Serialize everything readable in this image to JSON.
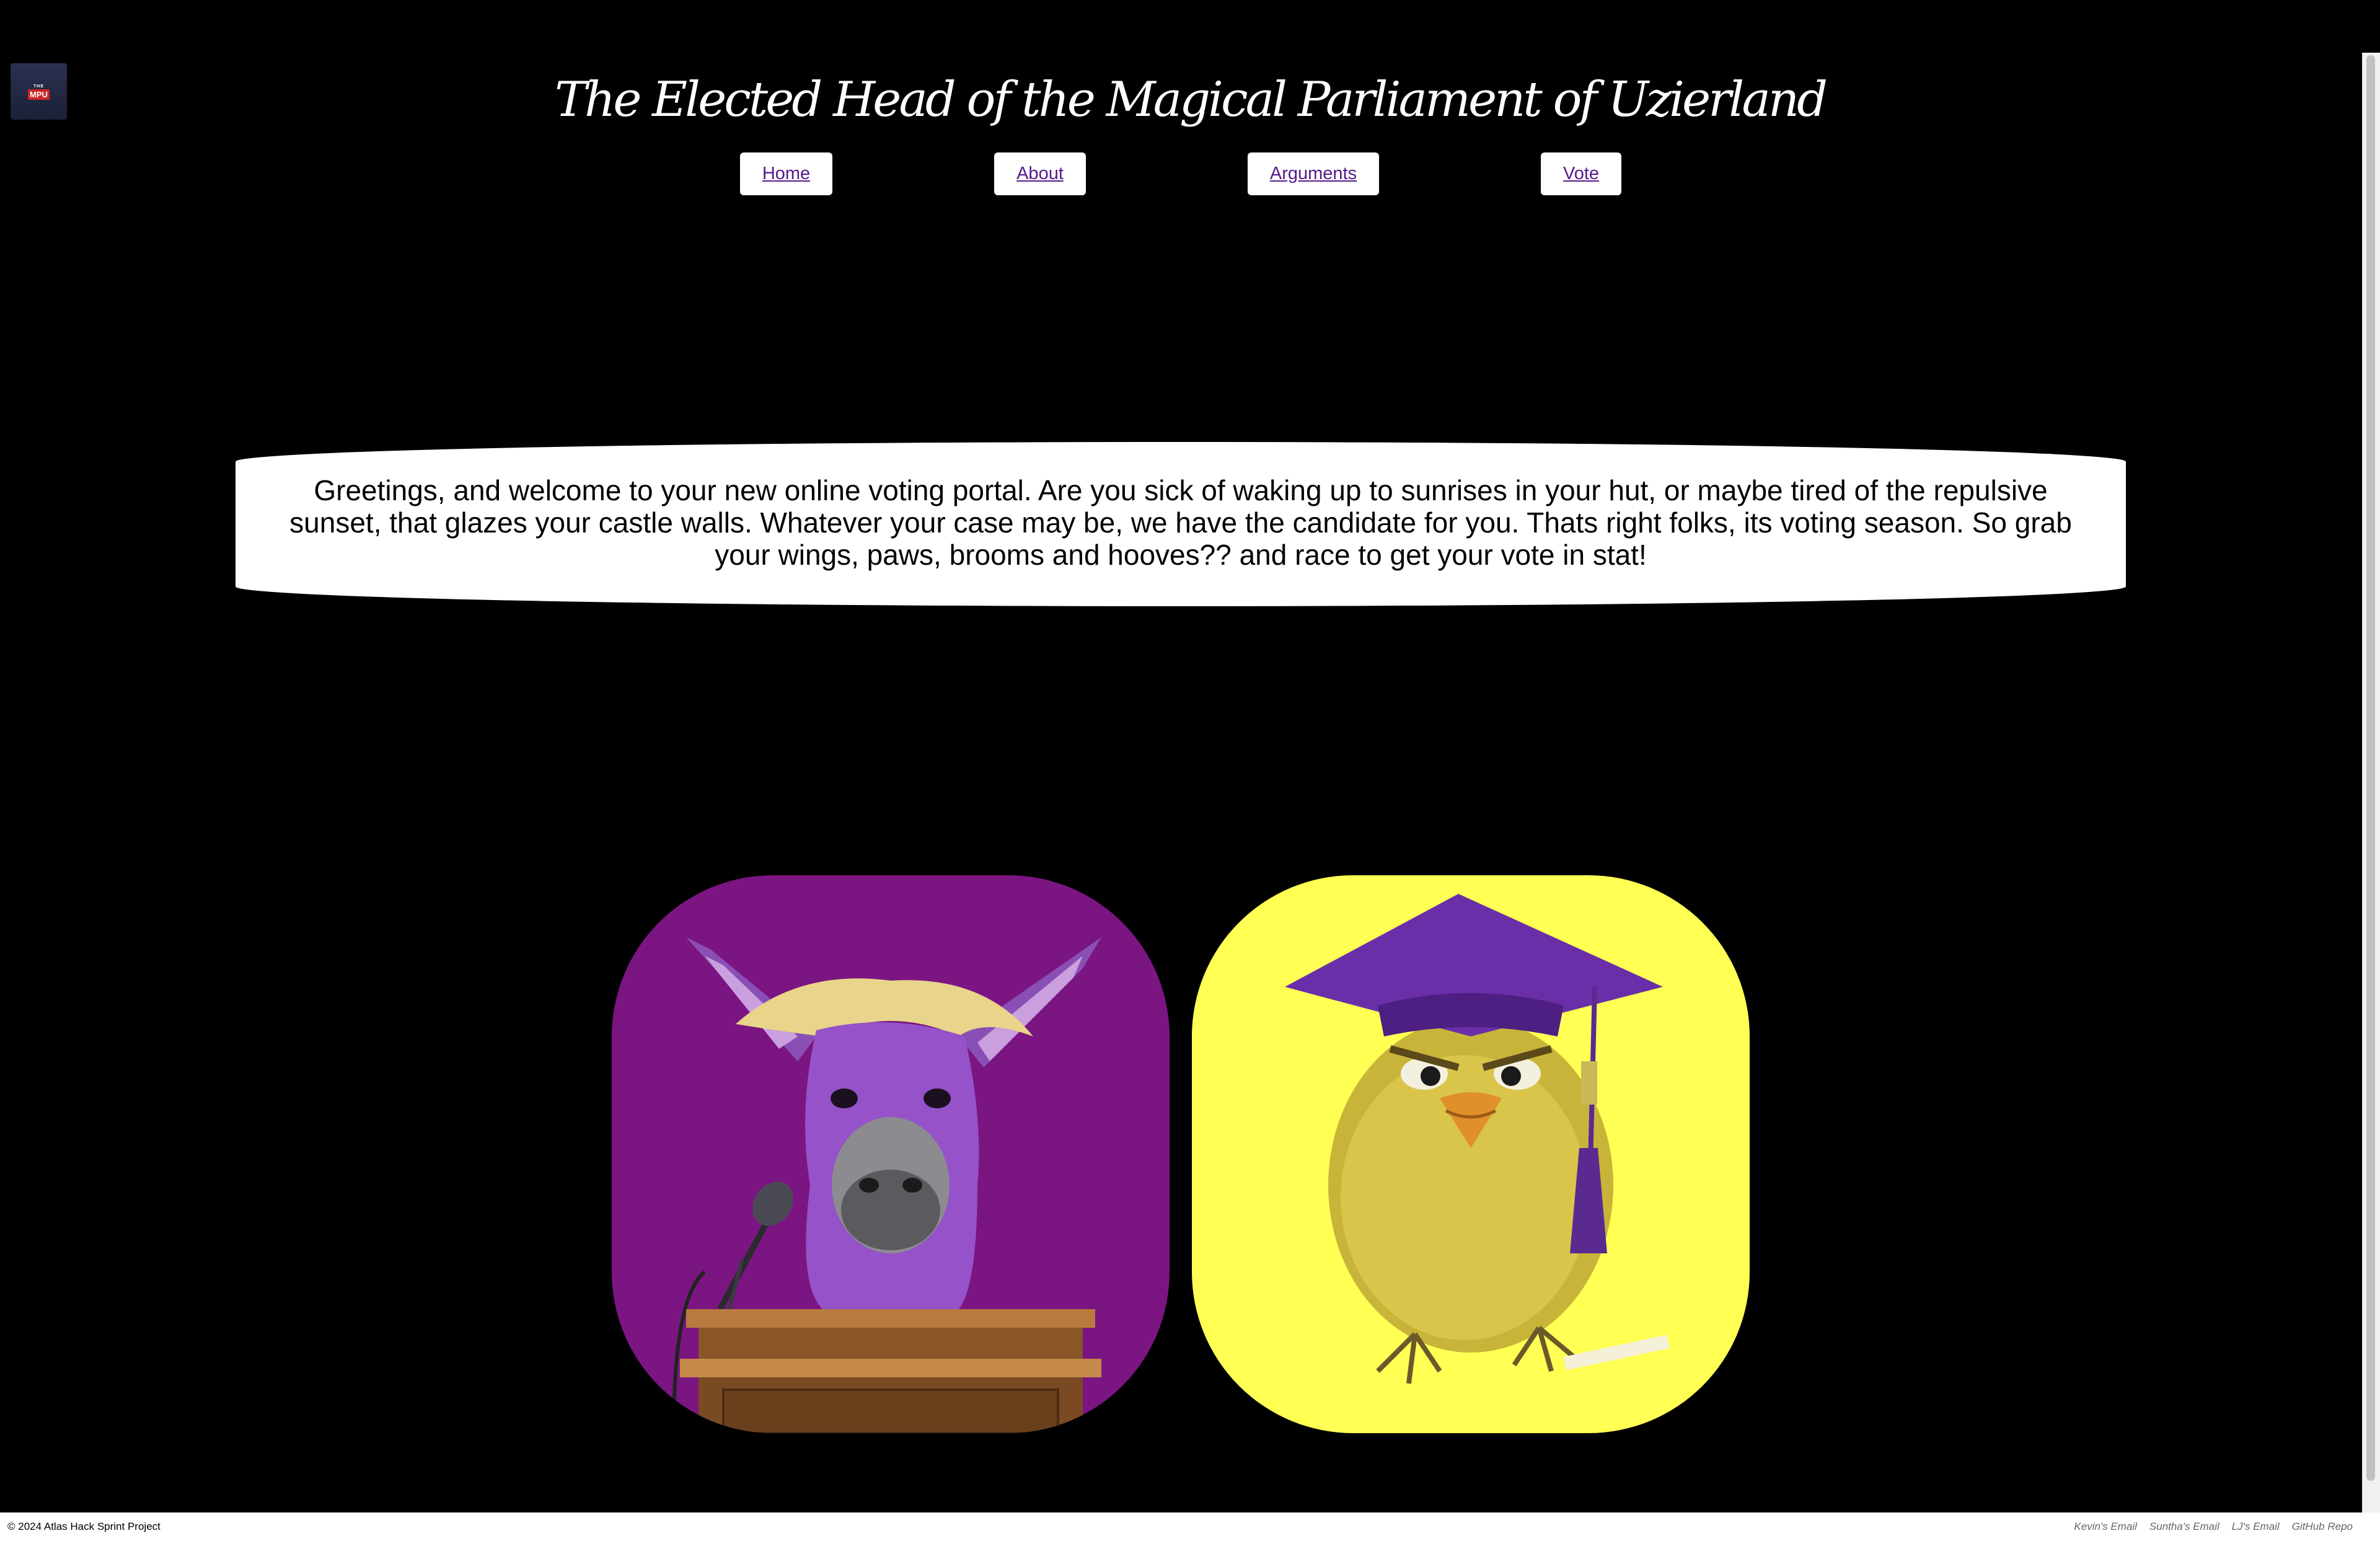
{
  "logo": {
    "top_text": "THE",
    "main_text": "MPU"
  },
  "header": {
    "title": "The Elected Head of the Magical Parliament of Uzierland"
  },
  "nav": {
    "home": "Home",
    "about": "About",
    "arguments": "Arguments",
    "vote": "Vote"
  },
  "welcome": {
    "text": "Greetings, and welcome to your new online voting portal. Are you sick of waking up to sunrises in your hut, or maybe tired of the repulsive sunset, that glazes your castle walls. Whatever your case may be, we have the candidate for you. Thats right folks, its voting season. So grab your wings, paws, brooms and hooves?? and race to get your vote in stat!"
  },
  "candidates": [
    {
      "name": "donkey-candidate",
      "bg_color": "#7b1582"
    },
    {
      "name": "chick-candidate",
      "bg_color": "#ffff54"
    }
  ],
  "footer": {
    "copyright": "© 2024 Atlas Hack Sprint Project",
    "links": [
      "Kevin's Email",
      "Suntha's Email",
      "LJ's Email",
      "GitHub Repo"
    ]
  }
}
